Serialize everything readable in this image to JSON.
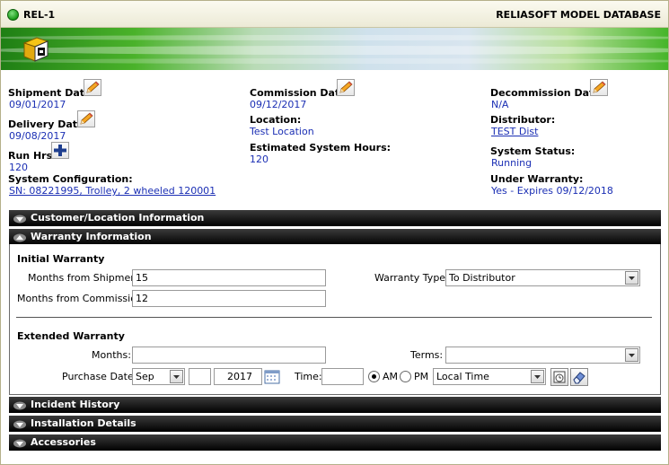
{
  "header": {
    "record_id": "REL-1",
    "app_title": "RELIASOFT MODEL DATABASE"
  },
  "icons": {
    "status": "status-dot-icon",
    "app": "app-logo-icon",
    "edit": "pencil-icon",
    "add": "plus-icon",
    "calendar": "calendar-icon",
    "clock": "clock-icon",
    "eraser": "eraser-icon",
    "expand": "chevron-down-icon",
    "collapse": "chevron-up-icon"
  },
  "colors": {
    "link": "#1b2fb4",
    "status_green": "#1a9b1a",
    "section_bg": "#000000"
  },
  "details": {
    "shipment_date": {
      "label": "Shipment Date:",
      "value": "09/01/2017"
    },
    "delivery_date": {
      "label": "Delivery Date:",
      "value": "09/08/2017"
    },
    "run_hrs": {
      "label": "Run Hrs:",
      "value": "120"
    },
    "system_configuration": {
      "label": "System Configuration:",
      "value": "SN: 08221995, Trolley, 2 wheeled 120001"
    },
    "commission_date": {
      "label": "Commission Date:",
      "value": "09/12/2017"
    },
    "location": {
      "label": "Location:",
      "value": "Test Location"
    },
    "estimated_system_hours": {
      "label": "Estimated System Hours:",
      "value": "120"
    },
    "decommission_date": {
      "label": "Decommission Date:",
      "value": "N/A"
    },
    "distributor": {
      "label": "Distributor:",
      "value": "TEST Dist"
    },
    "system_status": {
      "label": "System Status:",
      "value": "Running"
    },
    "under_warranty": {
      "label": "Under Warranty:",
      "value": "Yes - Expires 09/12/2018"
    }
  },
  "sections": {
    "customer_location": "Customer/Location Information",
    "warranty": "Warranty Information",
    "incident_history": "Incident History",
    "installation_details": "Installation Details",
    "accessories": "Accessories"
  },
  "warranty": {
    "initial_heading": "Initial Warranty",
    "months_from_shipment_label": "Months from Shipment:",
    "months_from_shipment_value": "15",
    "months_from_commission_label": "Months from Commission:",
    "months_from_commission_value": "12",
    "warranty_type_label": "Warranty Type:",
    "warranty_type_value": "To Distributor",
    "extended_heading": "Extended Warranty",
    "months_label": "Months:",
    "months_value": "",
    "terms_label": "Terms:",
    "terms_value": "",
    "purchase_date_label": "Purchase Date:",
    "purchase_month": "Sep",
    "purchase_day": "",
    "purchase_year": "2017",
    "time_label": "Time:",
    "time_value": "",
    "am_label": "AM",
    "pm_label": "PM",
    "ampm_selected": "AM",
    "timezone_value": "Local Time"
  }
}
